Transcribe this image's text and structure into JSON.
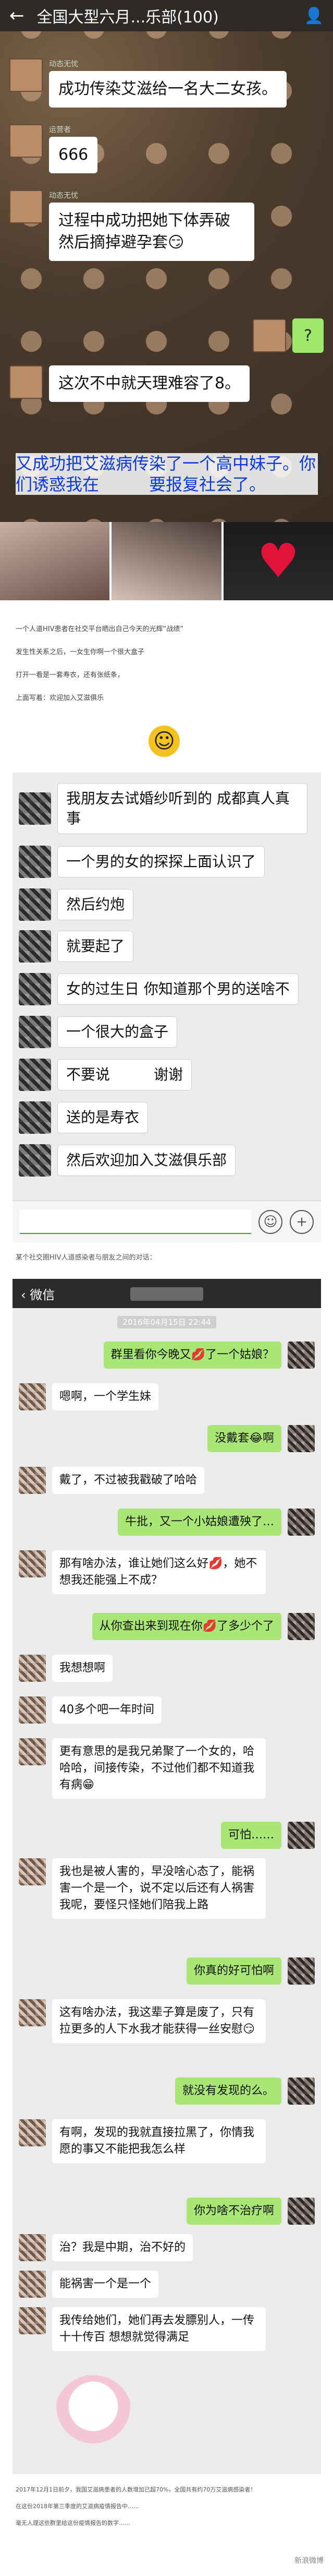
{
  "shot1": {
    "header": {
      "back_icon": "arrow-left-icon",
      "title": "全国大型六月...乐部",
      "member_count": "(100)",
      "people_icon": "people-icon"
    },
    "messages": [
      {
        "name": "动态无忧",
        "text": "成功传染艾滋给一名大二女孩。"
      },
      {
        "name": "运营者",
        "text": "666"
      },
      {
        "name": "动态无忧",
        "text": "过程中成功把她下体弄破然后摘掉避孕套😏"
      },
      {
        "name": "",
        "text": "这次不中就天理难容了8。"
      }
    ],
    "reply": "?",
    "caption": "又成功把艾滋病传染了一个高中妹子。你们诱惑我在　　　要报复社会了。"
  },
  "article": {
    "lines": [
      "一个人道HIV患者在社交平台晒出自己今天的光辉“战绩”",
      "发生性关系之后，一女生你啊一个很大盒子",
      "打开一看是一套寿衣，还有张纸条，",
      "上面写着：欢迎加入艾滋俱乐"
    ]
  },
  "shot2": {
    "messages": [
      "我朋友去试婚纱听到的 成都真人真事",
      "一个男的女的探探上面认识了",
      "然后约炮",
      "就要起了",
      "女的过生日 你知道那个男的送啥不",
      "一个很大的盒子",
      "不要说　　　谢谢",
      "送的是寿衣",
      "然后欢迎加入艾滋俱乐部"
    ],
    "note": "某个社交圈HIV人道感染者与朋友之间的对话："
  },
  "shot3": {
    "header": {
      "back_label": "微信"
    },
    "time1": "2016年04月15日 22:44",
    "messages": [
      {
        "side": "right",
        "text": "群里看你今晚又💋了一个姑娘？"
      },
      {
        "side": "left",
        "text": "嗯啊，一个学生妹"
      },
      {
        "side": "right",
        "text": "没戴套😂啊"
      },
      {
        "side": "left",
        "text": "戴了，不过被我戳破了哈哈"
      },
      {
        "side": "right",
        "text": "牛批，又一个小姑娘遭殃了…"
      },
      {
        "side": "left",
        "text": "那有啥办法，谁让她们这么好💋，她不想我还能强上不成？"
      },
      {
        "side": "right",
        "text": "从你查出来到现在你💋了多少个了"
      },
      {
        "side": "left",
        "text": "我想想啊"
      },
      {
        "side": "left",
        "text": "40多个吧一年时间"
      },
      {
        "side": "left",
        "text": "更有意思的是我兄弟聚了一个女的，哈哈哈，间接传染，不过他们都不知道我有病😁"
      },
      {
        "side": "right",
        "text": "可怕……"
      },
      {
        "side": "left",
        "text": "我也是被人害的，早没啥心态了，能祸害一个是一个，说不定以后还有人祸害我呢，要怪只怪她们陪我上路"
      },
      {
        "side": "right",
        "text": "你真的好可怕啊"
      },
      {
        "side": "left",
        "text": "这有啥办法，我这辈子算是废了，只有拉更多的人下水我才能获得一丝安慰😏"
      },
      {
        "side": "right",
        "text": "就没有发现的么。"
      },
      {
        "side": "left",
        "text": "有啊，发现的我就直接拉黑了，你情我愿的事又不能把我怎么样"
      },
      {
        "side": "right",
        "text": "你为啥不治疗啊"
      },
      {
        "side": "left",
        "text": "治？我是中期，治不好的"
      },
      {
        "side": "left",
        "text": "能祸害一个是一个"
      },
      {
        "side": "left",
        "text": "我传给她们，她们再去发膘别人，一传十十传百 想想就觉得满足"
      }
    ]
  },
  "footer": {
    "lines": [
      "2017年12月1日前夕，我国艾滋病患者的人数增加已超70%，全国共有约70万艾滋病感染者！",
      "在这份2018年第三季度的艾滋病疫情报告中……",
      "毫无人理这些群里给这份疫情报告的数字……"
    ],
    "watermark": "新浪微博"
  }
}
